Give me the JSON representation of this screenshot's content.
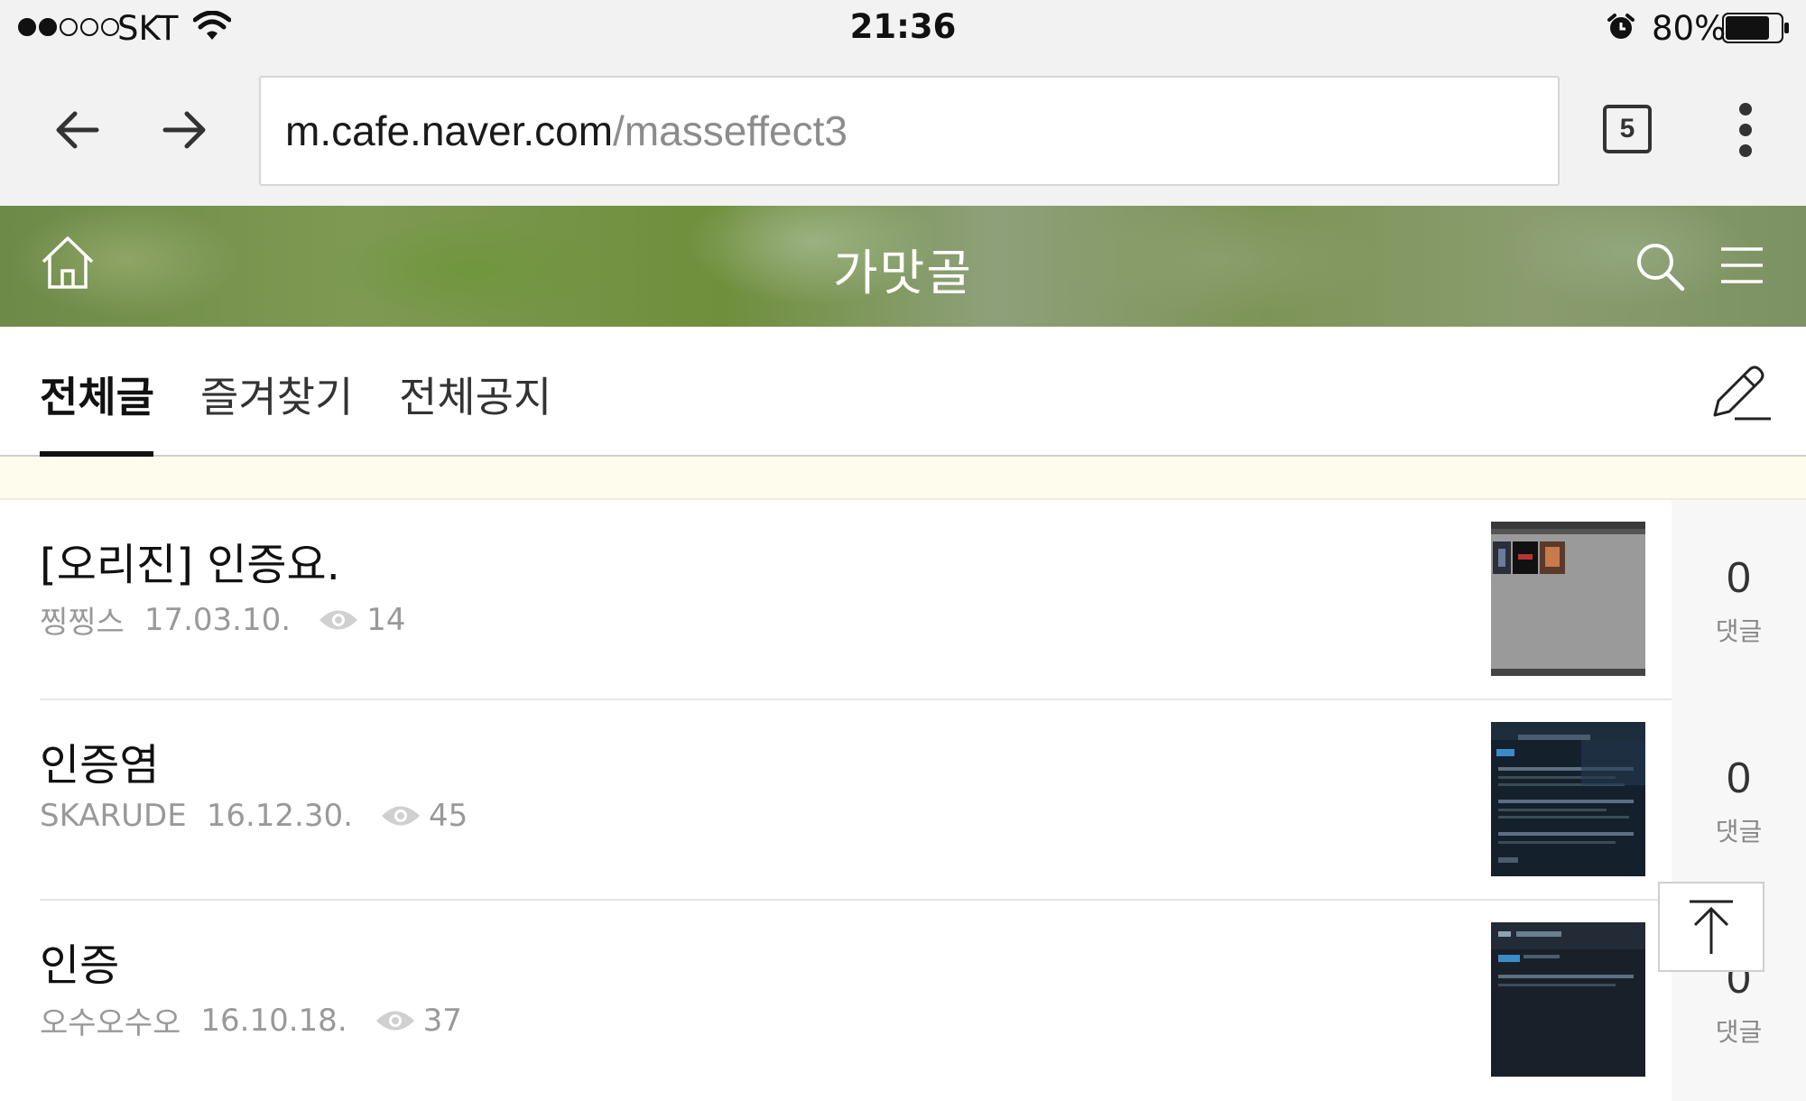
{
  "status_bar": {
    "carrier": "SKT",
    "time": "21:36",
    "battery_percent": "80%",
    "battery_level": 0.8,
    "signal_bars_filled": 2,
    "signal_bars_total": 5
  },
  "browser": {
    "url_host": "m.cafe.naver.com",
    "url_path": "/masseffect3",
    "tab_count": "5"
  },
  "cafe": {
    "title": "가맛골"
  },
  "tabs": [
    {
      "label": "전체글",
      "active": true
    },
    {
      "label": "즐겨찾기",
      "active": false
    },
    {
      "label": "전체공지",
      "active": false
    }
  ],
  "posts": [
    {
      "title": "[오리진] 인증요.",
      "author": "찡찡스",
      "date": "17.03.10.",
      "views": "14",
      "comments": "0",
      "comment_label": "댓글"
    },
    {
      "title": "인증염",
      "author": "SKARUDE",
      "date": "16.12.30.",
      "views": "45",
      "comments": "0",
      "comment_label": "댓글"
    },
    {
      "title": "인증",
      "author": "오수오수오",
      "date": "16.10.18.",
      "views": "37",
      "comments": "0",
      "comment_label": "댓글"
    }
  ],
  "colors": {
    "header_green": "#7e9a52",
    "notice_strip": "#fefcec",
    "meta_gray": "#999999"
  }
}
